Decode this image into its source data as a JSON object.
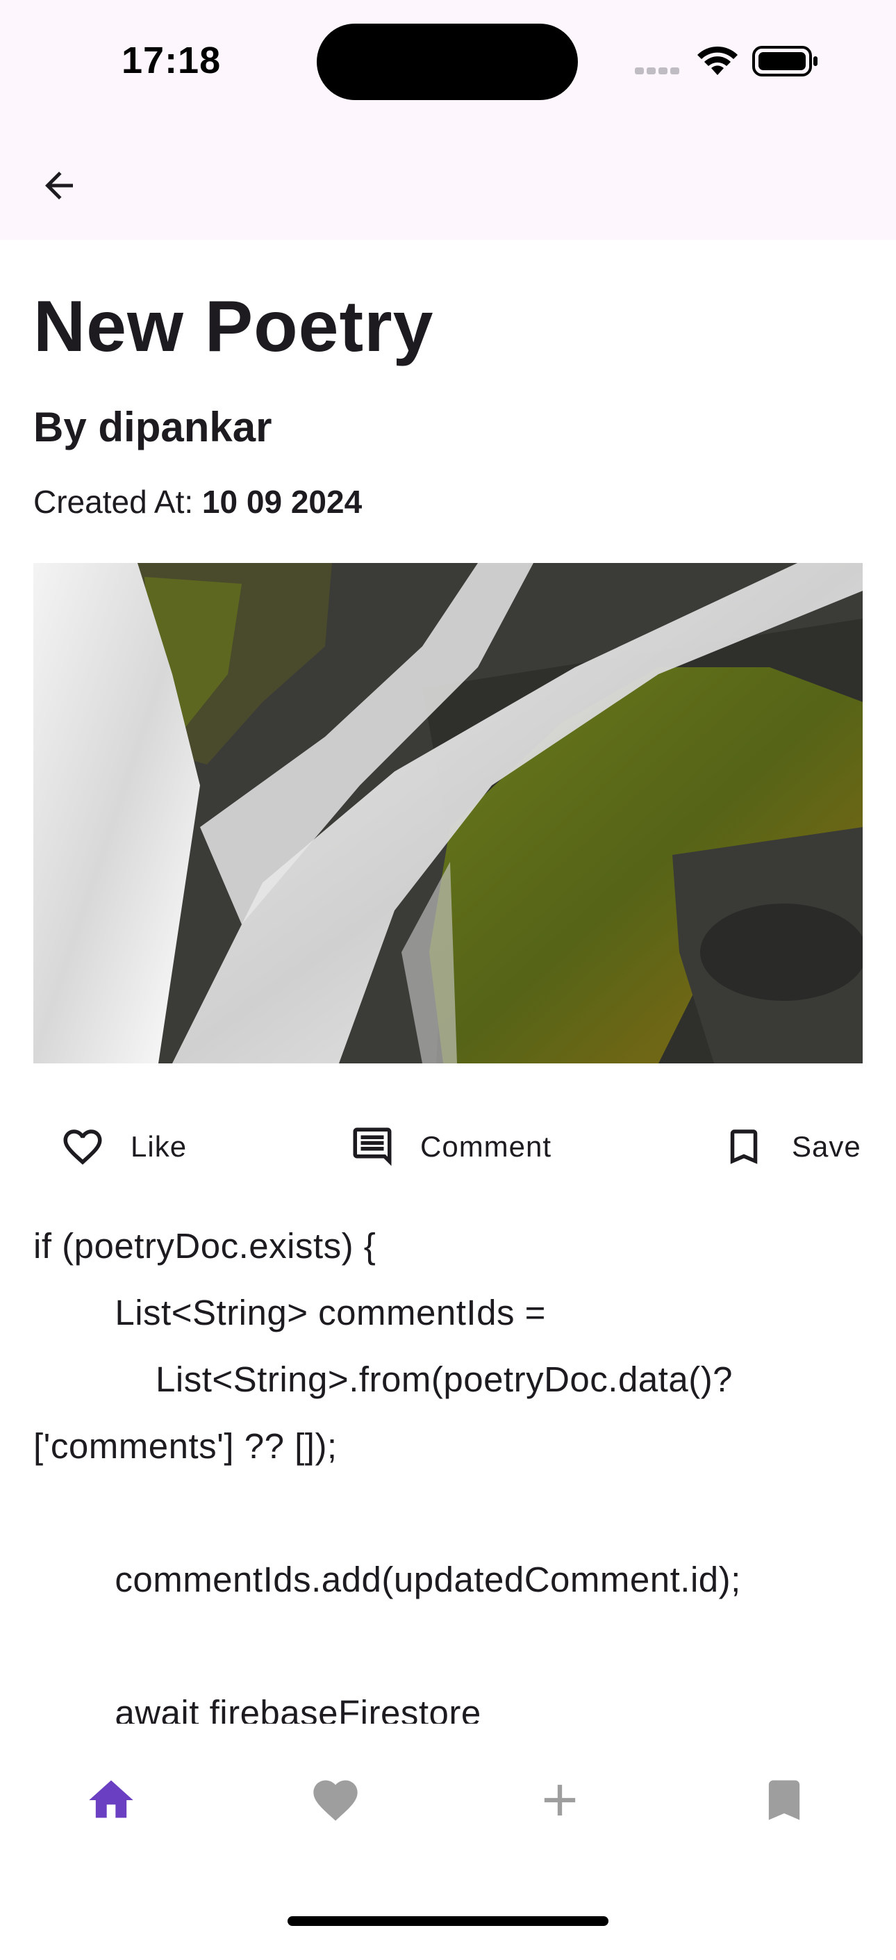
{
  "status_bar": {
    "time": "17:18"
  },
  "app_bar": {
    "back_icon": "arrow-left-icon"
  },
  "post": {
    "title": "New Poetry",
    "author": "By dipankar",
    "created_label": "Created At: ",
    "created_value": "10 09 2024",
    "image_alt": "waterfall over mossy rocks"
  },
  "actions": {
    "like": {
      "label": "Like",
      "icon": "heart-outline-icon"
    },
    "comment": {
      "label": "Comment",
      "icon": "comment-icon"
    },
    "save": {
      "label": "Save",
      "icon": "bookmark-outline-icon"
    }
  },
  "body": {
    "text": "if (poetryDoc.exists) {\n        List<String> commentIds =\n            List<String>.from(poetryDoc.data()?\n['comments'] ?? []);\n\n        commentIds.add(updatedComment.id);\n\n        await firebaseFirestore"
  },
  "bottom_nav": {
    "items": [
      {
        "name": "home",
        "icon": "home-icon",
        "active": true
      },
      {
        "name": "favorites",
        "icon": "heart-icon",
        "active": false
      },
      {
        "name": "add",
        "icon": "plus-icon",
        "active": false
      },
      {
        "name": "saved",
        "icon": "bookmark-icon",
        "active": false
      }
    ],
    "active_color": "#6a3fc1",
    "inactive_color": "#9e9e9e"
  }
}
